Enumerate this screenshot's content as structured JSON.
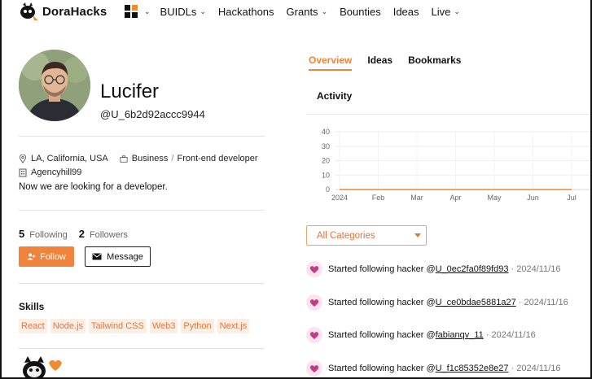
{
  "nav": {
    "brand": "DoraHacks",
    "items": [
      {
        "label": "BUIDLs",
        "dropdown": true
      },
      {
        "label": "Hackathons",
        "dropdown": false
      },
      {
        "label": "Grants",
        "dropdown": true
      },
      {
        "label": "Bounties",
        "dropdown": false
      },
      {
        "label": "Ideas",
        "dropdown": false
      },
      {
        "label": "Live",
        "dropdown": true
      }
    ]
  },
  "profile": {
    "name": "Lucifer",
    "handle": "@U_6b2d92accc9944",
    "location": "LA, California, USA",
    "work_type": "Business",
    "separator": "/",
    "role": "Front-end developer",
    "org": "Agencyhill99",
    "bio": "Now we are looking for a developer."
  },
  "stats": {
    "following_count": "5",
    "following_label": "Following",
    "followers_count": "2",
    "followers_label": "Followers"
  },
  "buttons": {
    "follow": "Follow",
    "message": "Message"
  },
  "skills": {
    "title": "Skills",
    "items": [
      "React",
      "Node.js",
      "Tailwind CSS",
      "Web3",
      "Python",
      "Next.js"
    ]
  },
  "tabs": [
    {
      "label": "Overview",
      "active": true
    },
    {
      "label": "Ideas",
      "active": false
    },
    {
      "label": "Bookmarks",
      "active": false
    }
  ],
  "activity": {
    "title": "Activity",
    "chart_data": {
      "type": "line",
      "x_ticks": [
        "2024",
        "Feb",
        "Mar",
        "Apr",
        "May",
        "Jun",
        "Jul"
      ],
      "y_ticks": [
        0,
        10,
        20,
        30,
        40
      ],
      "ylim": [
        0,
        40
      ],
      "series": [
        {
          "values": [
            0,
            0,
            0,
            0,
            0,
            0,
            0
          ]
        }
      ]
    }
  },
  "filter": {
    "selected": "All Categories"
  },
  "feed": [
    {
      "text": "Started following hacker @",
      "target": "U_0ec2fa0f89fd93",
      "date": "2024/11/16"
    },
    {
      "text": "Started following hacker @",
      "target": "U_ce0bdae5881a27",
      "date": "2024/11/16"
    },
    {
      "text": "Started following hacker @",
      "target": "fabianqv_11",
      "date": "2024/11/16"
    },
    {
      "text": "Started following hacker @",
      "target": "U_f1c85352e8e27",
      "date": "2024/11/16"
    }
  ],
  "colors": {
    "accent": "#f0843c",
    "skill_bg": "#fdeee4",
    "heart_bg": "#fbe3ef"
  }
}
